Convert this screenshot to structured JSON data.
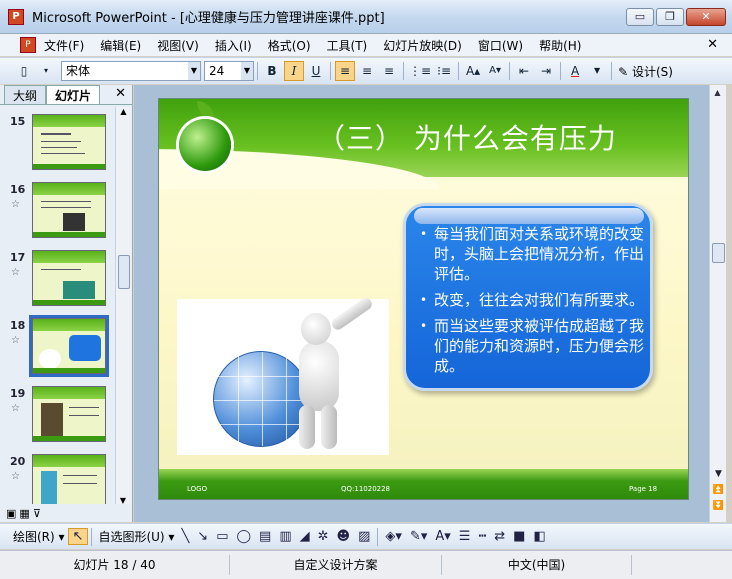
{
  "window": {
    "title": "Microsoft PowerPoint - [心理健康与压力管理讲座课件.ppt]",
    "app_icon": "P",
    "minimize": "▭",
    "restore": "❐",
    "close": "✕"
  },
  "menu": {
    "items": [
      "文件(F)",
      "编辑(E)",
      "视图(V)",
      "插入(I)",
      "格式(O)",
      "工具(T)",
      "幻灯片放映(D)",
      "窗口(W)",
      "帮助(H)"
    ],
    "close": "✕"
  },
  "toolbar": {
    "font_name": "宋体",
    "font_size": "24",
    "bold": "B",
    "italic": "I",
    "underline": "U",
    "design_label": "设计(S)"
  },
  "left_panel": {
    "tabs": [
      "大纲",
      "幻灯片"
    ],
    "active_tab": "幻灯片",
    "close": "✕",
    "slides": [
      {
        "number": "15",
        "star": ""
      },
      {
        "number": "16",
        "star": "☆"
      },
      {
        "number": "17",
        "star": "☆"
      },
      {
        "number": "18",
        "star": "☆"
      },
      {
        "number": "19",
        "star": "☆"
      },
      {
        "number": "20",
        "star": "☆"
      }
    ],
    "selected": "18"
  },
  "slide": {
    "title": "（三） 为什么会有压力",
    "bullets": [
      "每当我们面对关系或环境的改变时，头脑上会把情况分析，作出评估。",
      "改变，往往会对我们有所要求。",
      "而当这些要求被评估成超越了我们的能力和资源时，压力便会形成。"
    ],
    "footer_logo": "LOGO",
    "footer_qq": "QQ:11020228",
    "footer_page": "Page 18"
  },
  "drawbar": {
    "draw_label": "绘图(R)",
    "autoshape_label": "自选图形(U)"
  },
  "status": {
    "slide_info": "幻灯片 18 / 40",
    "design": "自定义设计方案",
    "language": "中文(中国)"
  },
  "colors": {
    "slide_green": "#4aa812",
    "textbox_blue": "#1f74e0",
    "selection": "#316ac5"
  }
}
